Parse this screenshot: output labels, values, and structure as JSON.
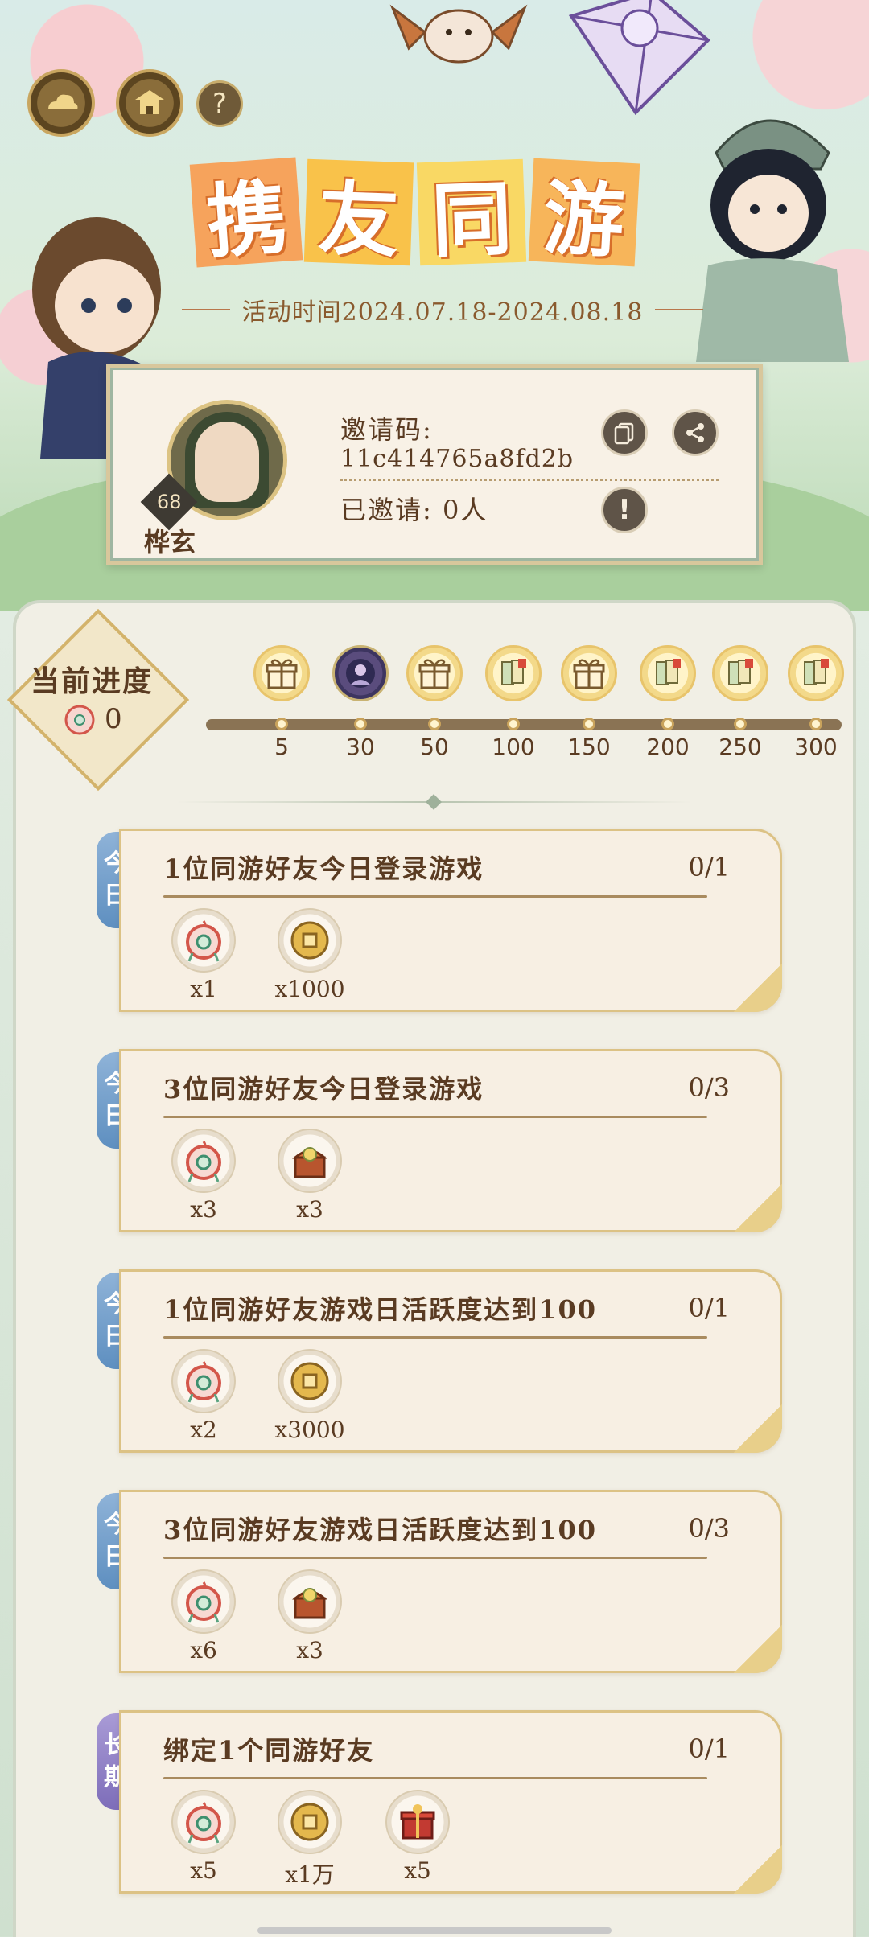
{
  "banner": {
    "title_chars": [
      "携",
      "友",
      "同",
      "游"
    ],
    "activity_time": "活动时间2024.07.18-2024.08.18",
    "help_label": "?"
  },
  "profile": {
    "player_name": "桦玄",
    "level": "68",
    "invite_code_label": "邀请码:",
    "invite_code": "11c414765a8fd2b",
    "invited_label": "已邀请: 0人",
    "info_label": "!"
  },
  "progress": {
    "title": "当前进度",
    "value": "0",
    "milestones": [
      {
        "label": "5",
        "icon": "gift-icon"
      },
      {
        "label": "30",
        "icon": "portrait-frame-icon"
      },
      {
        "label": "50",
        "icon": "gift-icon"
      },
      {
        "label": "100",
        "icon": "scroll-bundle-icon"
      },
      {
        "label": "150",
        "icon": "gift-icon"
      },
      {
        "label": "200",
        "icon": "scroll-bundle-icon"
      },
      {
        "label": "250",
        "icon": "scroll-bundle-icon"
      },
      {
        "label": "300",
        "icon": "scroll-bundle-icon"
      }
    ]
  },
  "tasks": [
    {
      "tag": [
        "今",
        "日"
      ],
      "title": "1位同游好友今日登录游戏",
      "progress": "0/1",
      "rewards": [
        {
          "icon": "jade-token-icon",
          "count": "x1"
        },
        {
          "icon": "copper-coin-icon",
          "count": "x1000"
        }
      ]
    },
    {
      "tag": [
        "今",
        "日"
      ],
      "title": "3位同游好友今日登录游戏",
      "progress": "0/3",
      "rewards": [
        {
          "icon": "jade-token-icon",
          "count": "x3"
        },
        {
          "icon": "treasure-chest-icon",
          "count": "x3"
        }
      ]
    },
    {
      "tag": [
        "今",
        "日"
      ],
      "title": "1位同游好友游戏日活跃度达到100",
      "progress": "0/1",
      "rewards": [
        {
          "icon": "jade-token-icon",
          "count": "x2"
        },
        {
          "icon": "copper-coin-icon",
          "count": "x3000"
        }
      ]
    },
    {
      "tag": [
        "今",
        "日"
      ],
      "title": "3位同游好友游戏日活跃度达到100",
      "progress": "0/3",
      "rewards": [
        {
          "icon": "jade-token-icon",
          "count": "x6"
        },
        {
          "icon": "treasure-chest-icon",
          "count": "x3"
        }
      ]
    },
    {
      "tag": [
        "长",
        "期"
      ],
      "title": "绑定1个同游好友",
      "progress": "0/1",
      "rewards": [
        {
          "icon": "jade-token-icon",
          "count": "x5"
        },
        {
          "icon": "copper-coin-icon",
          "count": "x1万"
        },
        {
          "icon": "red-gift-box-icon",
          "count": "x5"
        }
      ]
    }
  ],
  "colors": {
    "accent_gold": "#d3b36b",
    "text_brown": "#5a3b22",
    "tag_daily": "#5e8fc0",
    "tag_long": "#7d6db9"
  }
}
